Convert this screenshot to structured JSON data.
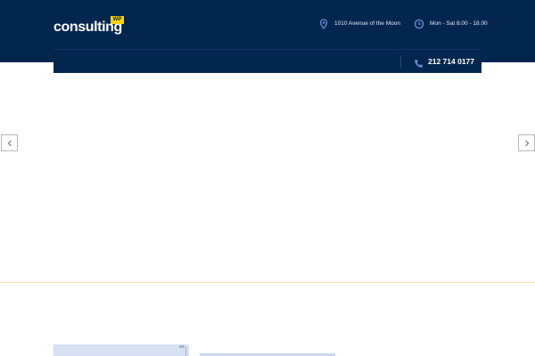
{
  "header": {
    "logo_text": "consulting",
    "logo_badge": "WP",
    "address": "1010 Avenue of the Moon",
    "hours": "Mon - Sat 8.00 - 18.00",
    "phone": "212 714 0177"
  },
  "icons": {
    "address": "map-pin-icon",
    "hours": "clock-icon",
    "phone": "phone-icon",
    "slider_prev": "chevron-left-icon",
    "slider_next": "chevron-right-icon"
  },
  "colors": {
    "header_bg": "#03264f",
    "icon_accent": "#6c8fd1",
    "badge": "#ffd400",
    "divider_gold": "#f5e2a4"
  }
}
